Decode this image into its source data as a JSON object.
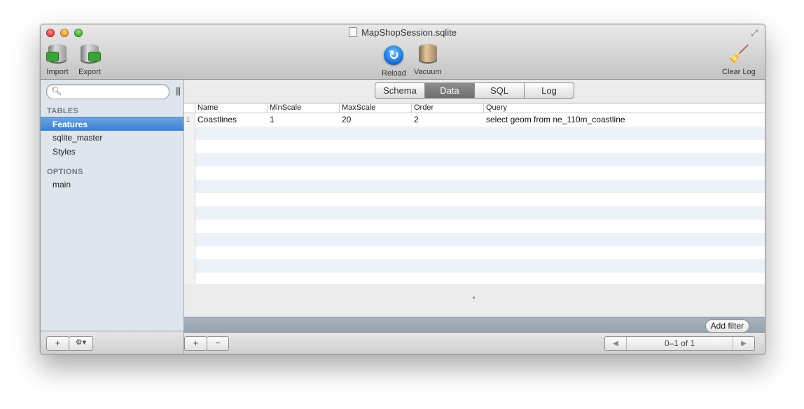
{
  "window": {
    "title": "MapShopSession.sqlite"
  },
  "toolbar": {
    "import_label": "Import",
    "export_label": "Export",
    "reload_label": "Reload",
    "vacuum_label": "Vacuum",
    "clear_log_label": "Clear Log"
  },
  "sidebar": {
    "search": {
      "value": "",
      "placeholder": ""
    },
    "tables_header": "TABLES",
    "tables": [
      "Features",
      "sqlite_master",
      "Styles"
    ],
    "selected_table": "Features",
    "options_header": "OPTIONS",
    "options": [
      "main"
    ],
    "footer": {
      "add_label": "+",
      "gear_label": "⚙▾"
    }
  },
  "tabs": [
    {
      "label": "Schema",
      "active": false
    },
    {
      "label": "Data",
      "active": true
    },
    {
      "label": "SQL",
      "active": false
    },
    {
      "label": "Log",
      "active": false
    }
  ],
  "table": {
    "columns": [
      "Name",
      "MinScale",
      "MaxScale",
      "Order",
      "Query"
    ],
    "rows": [
      {
        "num": "1",
        "cells": [
          "Coastlines",
          "1",
          "20",
          "2",
          "select geom from ne_110m_coastline"
        ]
      }
    ]
  },
  "filter": {
    "add_filter_label": "Add filter"
  },
  "main_footer": {
    "add_label": "+",
    "remove_label": "−",
    "pager": {
      "prev": "◀",
      "label": "0–1 of 1",
      "next": "▶"
    }
  }
}
